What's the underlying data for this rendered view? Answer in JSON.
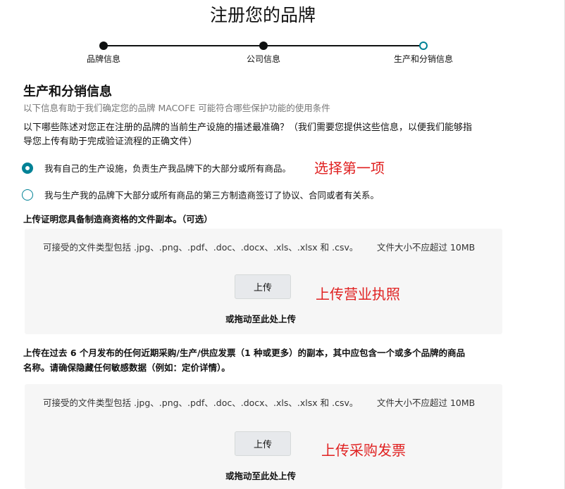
{
  "page": {
    "title": "注册您的品牌"
  },
  "stepper": {
    "steps": [
      {
        "label": "品牌信息",
        "state": "complete"
      },
      {
        "label": "公司信息",
        "state": "complete"
      },
      {
        "label": "生产和分销信息",
        "state": "current"
      }
    ]
  },
  "section": {
    "title": "生产和分销信息",
    "subtitle": "以下信息有助于我们确定您的品牌 MACOFE 可能符合哪些保护功能的使用条件",
    "question_line1": "以下哪些陈述对您正在注册的品牌的当前生产设施的描述最准确？（我们需要您提供这些信息，以便我们能够指",
    "question_line2": "导您上传有助于完成验证流程的正确文件）"
  },
  "options": [
    {
      "label": "我有自己的生产设施，负责生产我品牌下的大部分或所有商品。",
      "checked": true
    },
    {
      "label": "我与生产我的品牌下大部分或所有商品的第三方制造商签订了协议、合同或者有关系。",
      "checked": false
    }
  ],
  "annotations": {
    "option": "选择第一项",
    "upload1": "上传营业执照",
    "upload2": "上传采购发票"
  },
  "upload_manufacturing": {
    "label": "上传证明您具备制造商资格的文件副本。（可选）",
    "accepted_types": "可接受的文件类型包括 .jpg、.png、.pdf、.doc、.docx、.xls、.xlsx 和 .csv。",
    "size_limit": "文件大小不应超过 10MB",
    "button_label": "上传",
    "drag_hint": "或拖动至此处上传"
  },
  "upload_invoice": {
    "label_line1": "上传在过去 6 个月发布的任何近期采购/生产/供应发票（1 种或更多）的副本，其中应包含一个或多个品牌的商品",
    "label_line2": "名称。请确保隐藏任何敏感数据（例如：定价详情）。",
    "accepted_types": "可接受的文件类型包括 .jpg、.png、.pdf、.doc、.docx、.xls、.xlsx 和 .csv。",
    "size_limit": "文件大小不应超过 10MB",
    "button_label": "上传",
    "drag_hint": "或拖动至此处上传"
  },
  "colors": {
    "accent": "#008296",
    "annotation": "#e02020",
    "dropzone": "#f6f6f6"
  }
}
